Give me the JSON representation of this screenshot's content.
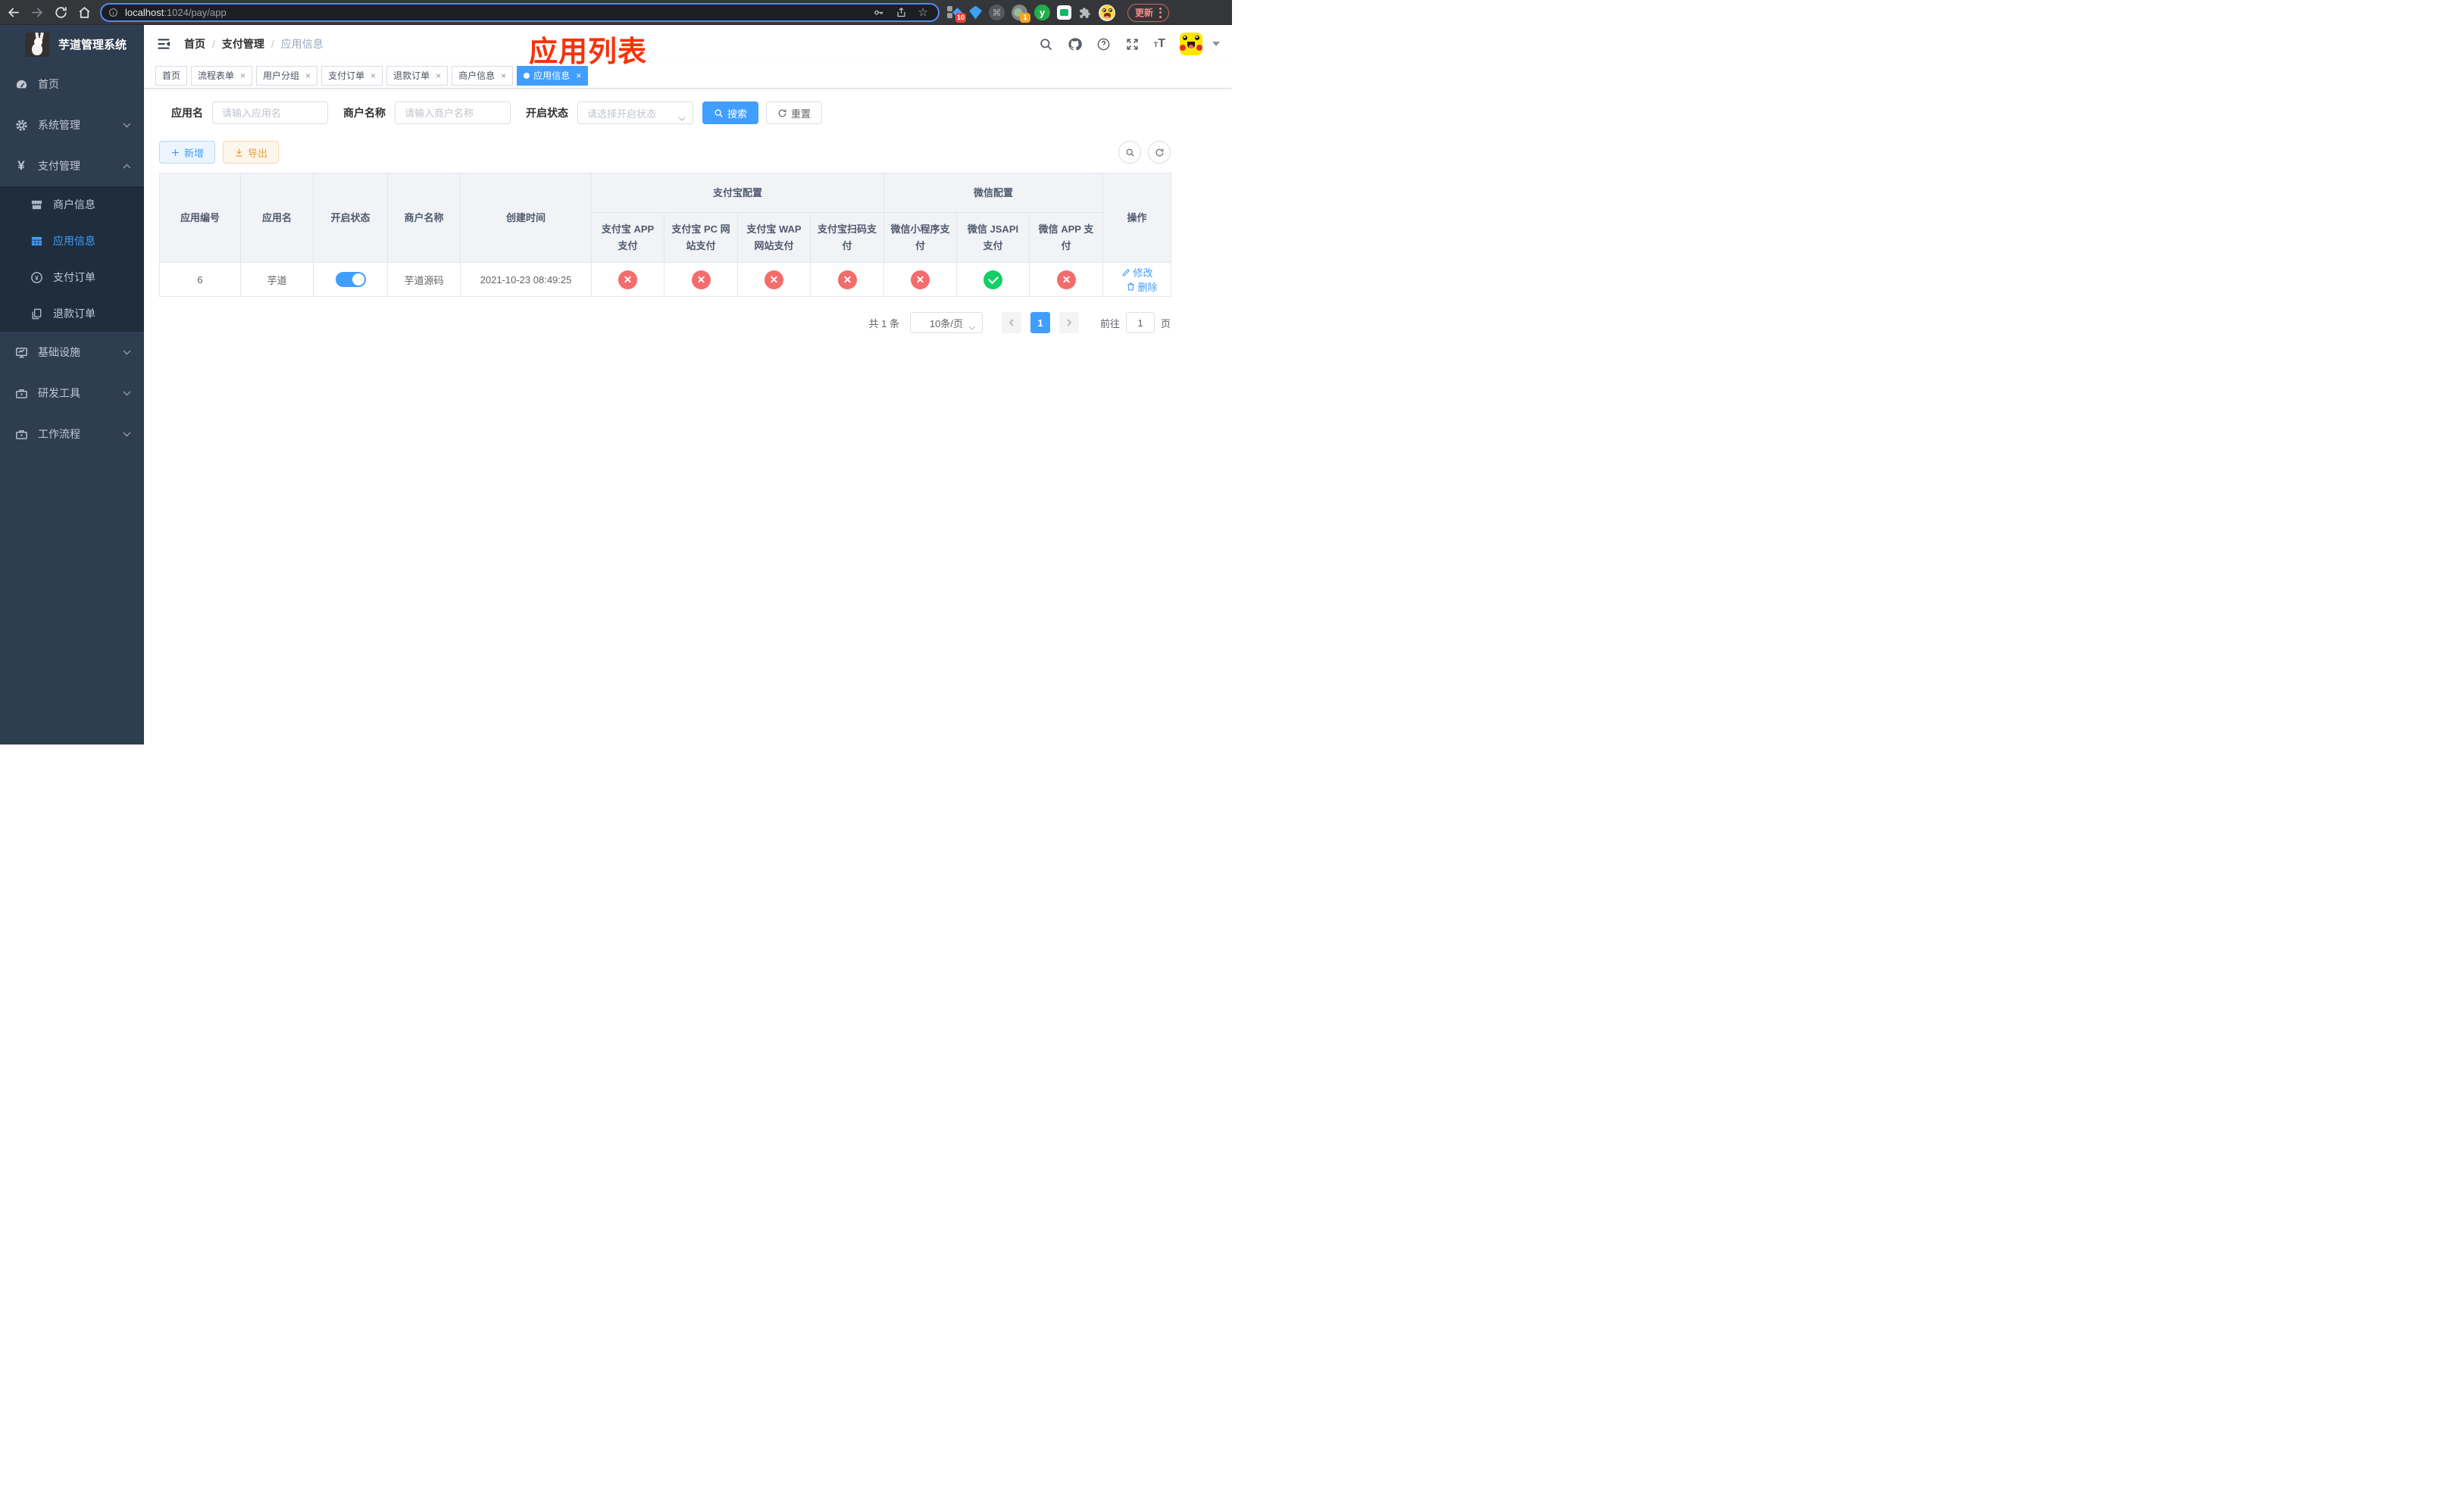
{
  "browser": {
    "url_domain": "localhost",
    "url_rest": ":1024/pay/app",
    "ext_badge_grid": "10",
    "ext_badge_cam": "1",
    "ext_y_letter": "y",
    "cmd_glyph": "⌘",
    "update_label": "更新"
  },
  "sidebar": {
    "title": "芋道管理系统",
    "items": [
      {
        "label": "首页",
        "icon": "dashboard-icon"
      },
      {
        "label": "系统管理",
        "icon": "gear-icon",
        "state": "collapsed"
      },
      {
        "label": "支付管理",
        "icon": "yen-icon",
        "state": "expanded"
      },
      {
        "label": "基础设施",
        "icon": "monitor-icon",
        "state": "collapsed"
      },
      {
        "label": "研发工具",
        "icon": "toolbox-icon",
        "state": "collapsed"
      },
      {
        "label": "工作流程",
        "icon": "briefcase-icon",
        "state": "collapsed"
      }
    ],
    "submenu": [
      {
        "label": "商户信息",
        "icon": "shop-icon",
        "active": false
      },
      {
        "label": "应用信息",
        "icon": "grid-icon",
        "active": true
      },
      {
        "label": "支付订单",
        "icon": "yen-circle-icon",
        "active": false
      },
      {
        "label": "退款订单",
        "icon": "document-icon",
        "active": false
      }
    ]
  },
  "navbar": {
    "breadcrumb": {
      "items": [
        "首页",
        "支付管理",
        "应用信息"
      ],
      "separator": "/"
    }
  },
  "overlay_title": "应用列表",
  "tags": [
    {
      "label": "首页",
      "closable": false,
      "active": false
    },
    {
      "label": "流程表单",
      "closable": true,
      "active": false
    },
    {
      "label": "用户分组",
      "closable": true,
      "active": false
    },
    {
      "label": "支付订单",
      "closable": true,
      "active": false
    },
    {
      "label": "退款订单",
      "closable": true,
      "active": false
    },
    {
      "label": "商户信息",
      "closable": true,
      "active": false
    },
    {
      "label": "应用信息",
      "closable": true,
      "active": true
    }
  ],
  "filter": {
    "fields": [
      {
        "label": "应用名",
        "placeholder": "请输入应用名",
        "type": "input"
      },
      {
        "label": "商户名称",
        "placeholder": "请输入商户名称",
        "type": "input"
      },
      {
        "label": "开启状态",
        "placeholder": "请选择开启状态",
        "type": "select"
      }
    ],
    "search_label": "搜索",
    "reset_label": "重置"
  },
  "toolbar": {
    "add_label": "新增",
    "export_label": "导出"
  },
  "table": {
    "columns": [
      "应用编号",
      "应用名",
      "开启状态",
      "商户名称",
      "创建时间"
    ],
    "groups": [
      {
        "label": "支付宝配置",
        "children": [
          "支付宝 APP 支付",
          "支付宝 PC 网站支付",
          "支付宝 WAP 网站支付",
          "支付宝扫码支付"
        ]
      },
      {
        "label": "微信配置",
        "children": [
          "微信小程序支付",
          "微信 JSAPI 支付",
          "微信 APP 支付"
        ]
      }
    ],
    "action_col": "操作",
    "row": {
      "id": "6",
      "name": "芋道",
      "enabled": true,
      "merchant": "芋道源码",
      "created": "2021-10-23 08:49:25",
      "configs": [
        false,
        false,
        false,
        false,
        false,
        true,
        false
      ],
      "actions": [
        "修改",
        "删除"
      ]
    }
  },
  "pagination": {
    "total_label": "共 1 条",
    "page_size_label": "10条/页",
    "current_page": "1",
    "goto_label": "前往",
    "goto_value": "1",
    "unit_label": "页"
  },
  "colors": {
    "accent": "#409eff",
    "success": "#13ce66",
    "danger": "#f56c6c",
    "warning": "#e6a23c",
    "sidebar_bg": "#2f3d50",
    "submenu_bg": "#1f2d3c",
    "title_red": "#f8320b"
  }
}
